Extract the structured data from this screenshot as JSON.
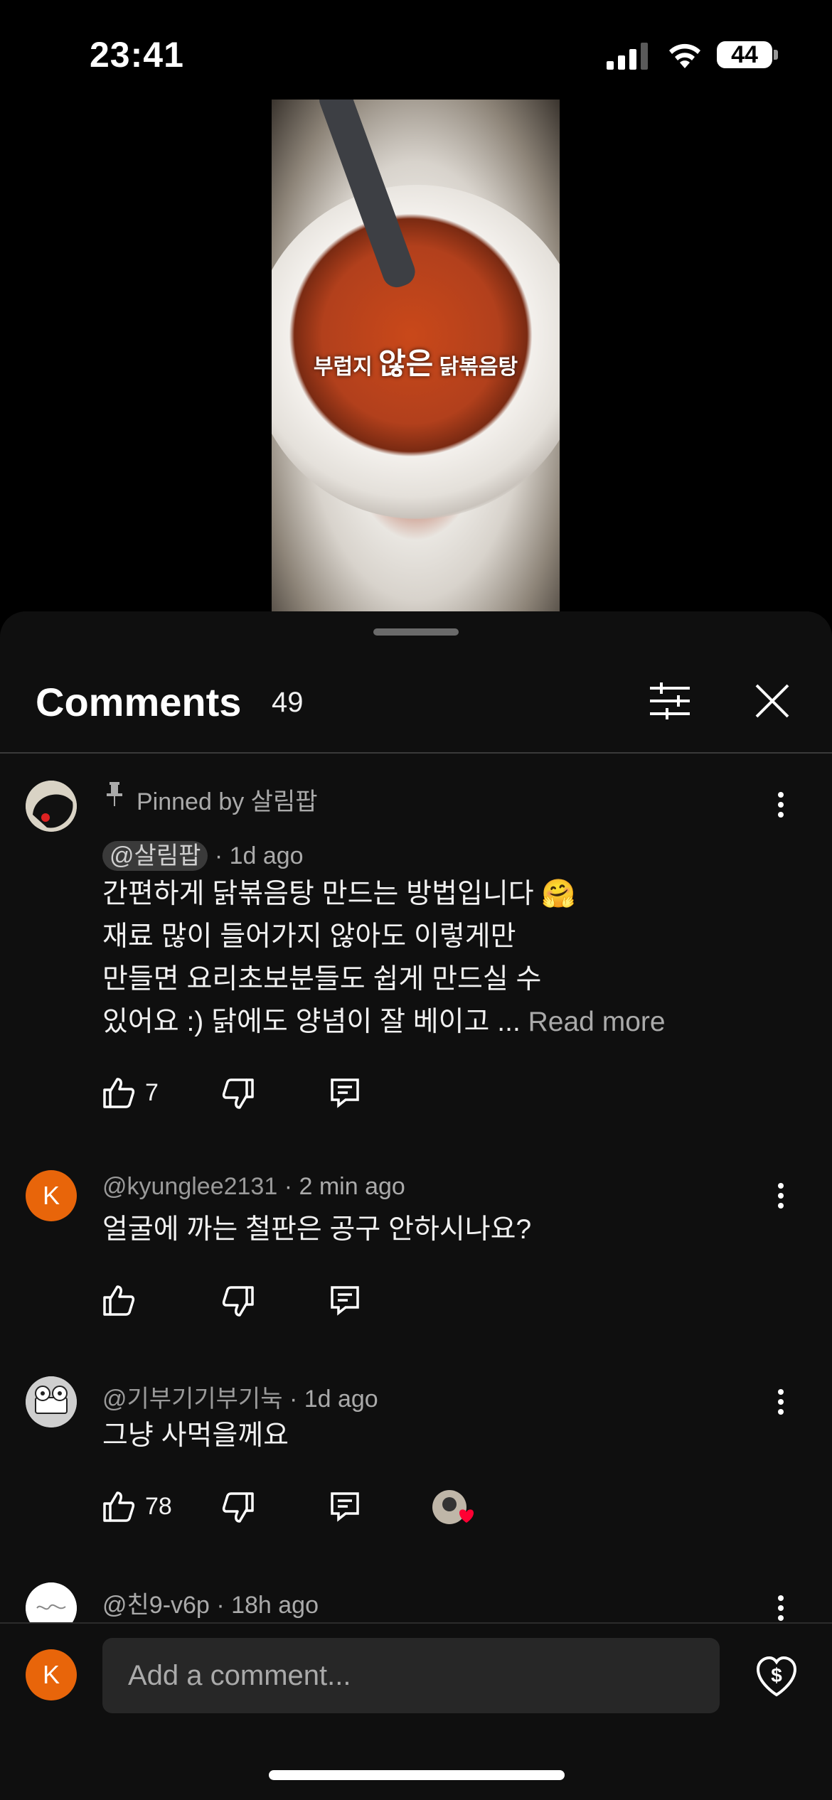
{
  "status_bar": {
    "time": "23:41",
    "battery": "44"
  },
  "video": {
    "caption_pre": "부럽지 ",
    "caption_big": "않은",
    "caption_post": " 닭볶음탕"
  },
  "sheet": {
    "title": "Comments",
    "count": "49"
  },
  "comments": [
    {
      "pinned_label": "Pinned by 살림팝",
      "author": "@살림팝",
      "time": "· 1d ago",
      "lines": [
        "간편하게 닭볶음탕 만드는 방법입니다 🤗",
        "재료 많이 들어가지 않아도 이렇게만",
        "만들면 요리초보분들도 쉽게 만드실 수",
        "있어요 :) 닭에도 양념이 잘 베이고 ..."
      ],
      "read_more": "Read more",
      "likes": "7"
    },
    {
      "avatar_letter": "K",
      "author": "@kyunglee2131",
      "time": "· 2 min ago",
      "text": "얼굴에 까는 철판은 공구 안하시나요?",
      "likes": ""
    },
    {
      "author": "@기부기기부기눅",
      "time": "· 1d ago",
      "text": "그냥 사먹을께요",
      "likes": "78"
    },
    {
      "author": "@친9-v6p",
      "time": "· 18h ago"
    }
  ],
  "composer": {
    "avatar_letter": "K",
    "placeholder": "Add a comment..."
  },
  "colors": {
    "sheet_bg": "#0f0f0f",
    "avatar_orange": "#e8650a",
    "heart_red": "#ff0033"
  }
}
